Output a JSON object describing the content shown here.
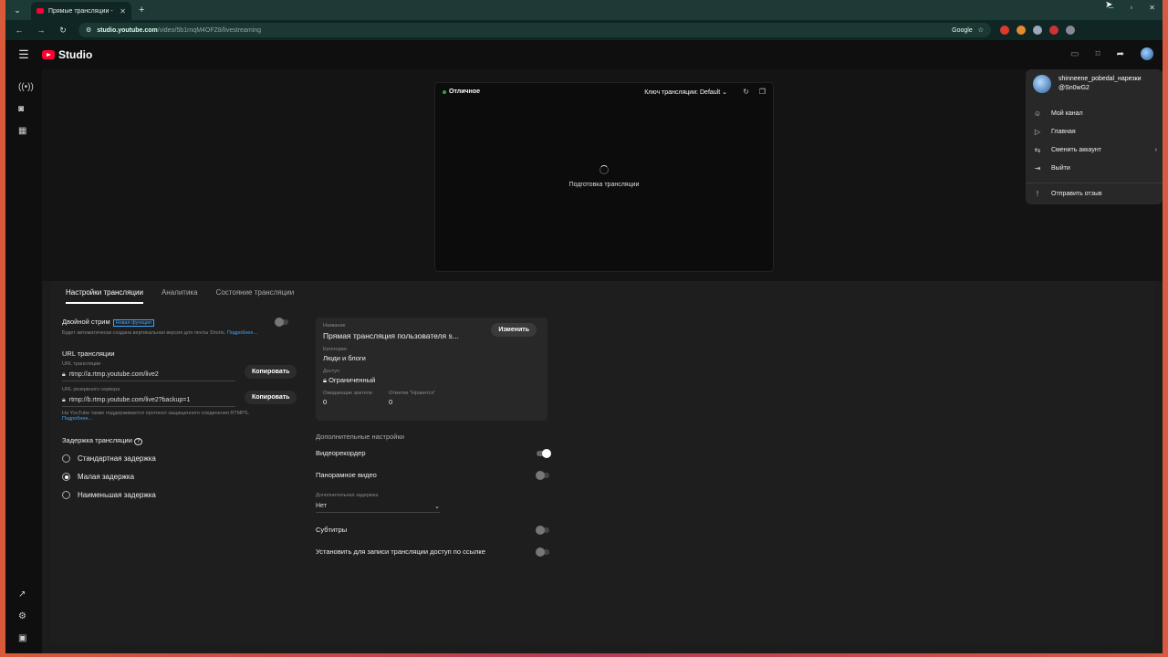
{
  "browser": {
    "tab_title": "Прямые трансляции - YouTube",
    "url_host": "studio.youtube.com",
    "url_path": "/video/5b1rnqM4OFZ8/livestreaming",
    "search_engine": "Google"
  },
  "studio": {
    "logo_text": "Studio"
  },
  "preview": {
    "status": "Отличное",
    "stream_key": "Ключ трансляции: Default",
    "preparing_text": "Подготовка трансляции"
  },
  "tabs": [
    "Настройки трансляции",
    "Аналитика",
    "Состояние трансляции"
  ],
  "settings": {
    "dual_stream_label": "Двойной стрим",
    "dual_stream_badge": "Новая функция",
    "dual_stream_desc": "Будет автоматически создана вертикальная версия для ленты Shorts.",
    "learn_more": "Подробнее...",
    "url_section": "URL трансляции",
    "url_label": "URL трансляции",
    "url_value": "rtmp://a.rtmp.youtube.com/live2",
    "backup_label": "URL резервного сервера",
    "backup_value": "rtmp://b.rtmp.youtube.com/live2?backup=1",
    "copy": "Копировать",
    "rtmps_note": "На YouTube также поддерживается протокол защищенного соединения RTMPS.",
    "learn_more2": "Подробнее...",
    "latency_label": "Задержка трансляции",
    "latency_options": [
      "Стандартная задержка",
      "Малая задержка",
      "Наименьшая задержка"
    ]
  },
  "info_card": {
    "name_label": "Название",
    "name_value": "Прямая трансляция пользователя s...",
    "change": "Изменить",
    "category_label": "Категория",
    "category_value": "Люди и блоги",
    "access_label": "Доступ",
    "access_value": "Ограниченный",
    "waiting_label": "Ожидающие зрители",
    "waiting_value": "0",
    "likes_label": "Отметки \"Нравится\"",
    "likes_value": "0"
  },
  "additional": {
    "title": "Дополнительные настройки",
    "dvr": "Видеорекордер",
    "panoramic": "Панорамное видео",
    "extra_delay_label": "Дополнительная задержка",
    "extra_delay_value": "Нет",
    "subtitles": "Субтитры",
    "unlisted": "Установить для записи трансляции доступ по ссылке"
  },
  "account_menu": {
    "name": "shinneene_pobedal_нарезки",
    "handle": "@Sn0wG2",
    "items": [
      "Мой канал",
      "Главная",
      "Сменить аккаунт",
      "Выйти",
      "Отправить отзыв"
    ]
  }
}
